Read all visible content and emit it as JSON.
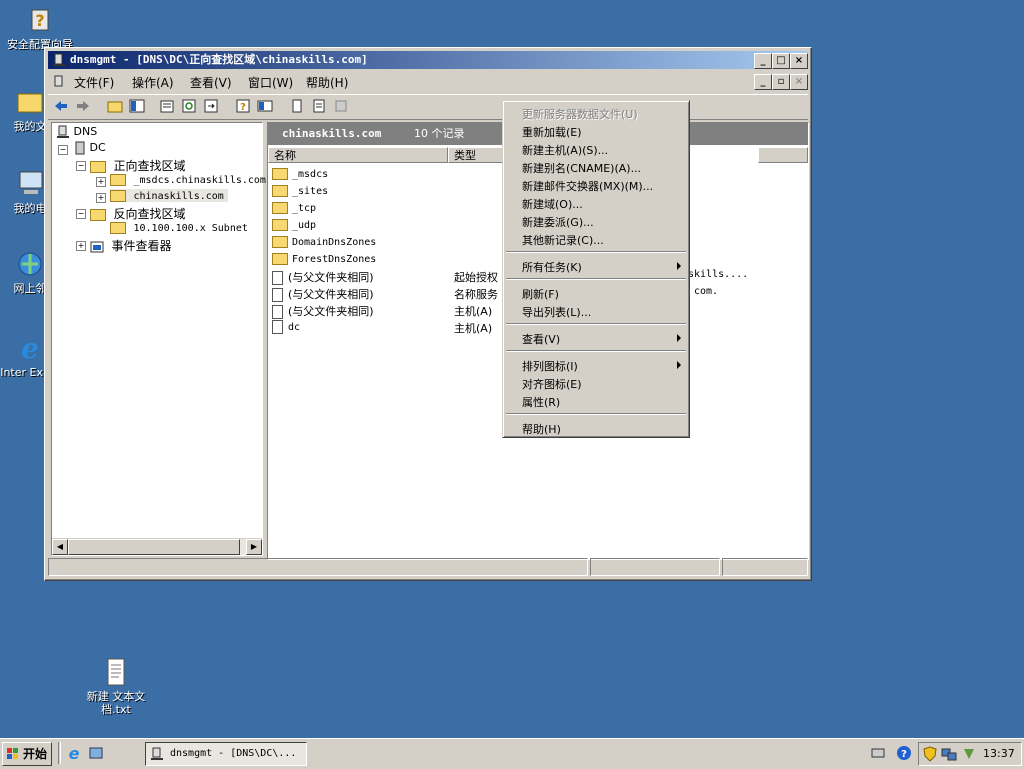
{
  "desktop": {
    "icons": [
      {
        "label": "安全配置向导",
        "icon": "security-wizard-icon"
      },
      {
        "label": "我的文",
        "icon": "my-documents-icon"
      },
      {
        "label": "我的电",
        "icon": "my-computer-icon"
      },
      {
        "label": "网上邻",
        "icon": "network-places-icon"
      },
      {
        "label": "Inter Explo",
        "icon": "internet-explorer-icon"
      },
      {
        "label": "新建 文本文档.txt",
        "icon": "text-file-icon"
      }
    ]
  },
  "window": {
    "title": "dnsmgmt - [DNS\\DC\\正向查找区域\\chinaskills.com]",
    "menu": [
      "文件(F)",
      "操作(A)",
      "查看(V)",
      "窗口(W)",
      "帮助(H)"
    ]
  },
  "tree": {
    "items": [
      "DNS",
      "DC",
      "正向查找区域",
      "_msdcs.chinaskills.com",
      "chinaskills.com",
      "反向查找区域",
      "10.100.100.x Subnet",
      "事件查看器"
    ]
  },
  "list": {
    "zone": "chinaskills.com",
    "count": "10 个记录",
    "columns": [
      "名称",
      "类型"
    ],
    "rows": [
      {
        "name": "_msdcs",
        "type": ""
      },
      {
        "name": "_sites",
        "type": ""
      },
      {
        "name": "_tcp",
        "type": ""
      },
      {
        "name": "_udp",
        "type": ""
      },
      {
        "name": "DomainDnsZones",
        "type": ""
      },
      {
        "name": "ForestDnsZones",
        "type": ""
      },
      {
        "name": "(与父文件夹相同)",
        "type": "起始授权",
        "extra": "skills...."
      },
      {
        "name": "(与父文件夹相同)",
        "type": "名称服务",
        "extra": "com."
      },
      {
        "name": "(与父文件夹相同)",
        "type": "主机(A)",
        "extra": ""
      },
      {
        "name": "dc",
        "type": "主机(A)",
        "extra": ""
      }
    ]
  },
  "context_menu": {
    "items": [
      {
        "label": "更新服务器数据文件(U)",
        "disabled": true
      },
      {
        "label": "重新加载(E)"
      },
      {
        "label": "新建主机(A)(S)..."
      },
      {
        "label": "新建别名(CNAME)(A)..."
      },
      {
        "label": "新建邮件交换器(MX)(M)..."
      },
      {
        "label": "新建域(O)..."
      },
      {
        "label": "新建委派(G)..."
      },
      {
        "label": "其他新记录(C)..."
      },
      {
        "label": "所有任务(K)",
        "submenu": true
      },
      {
        "label": "刷新(F)"
      },
      {
        "label": "导出列表(L)..."
      },
      {
        "label": "查看(V)",
        "submenu": true
      },
      {
        "label": "排列图标(I)",
        "submenu": true
      },
      {
        "label": "对齐图标(E)"
      },
      {
        "label": "属性(R)"
      },
      {
        "label": "帮助(H)"
      }
    ]
  },
  "taskbar": {
    "start": "开始",
    "task": "dnsmgmt - [DNS\\DC\\...",
    "clock": "13:37"
  }
}
